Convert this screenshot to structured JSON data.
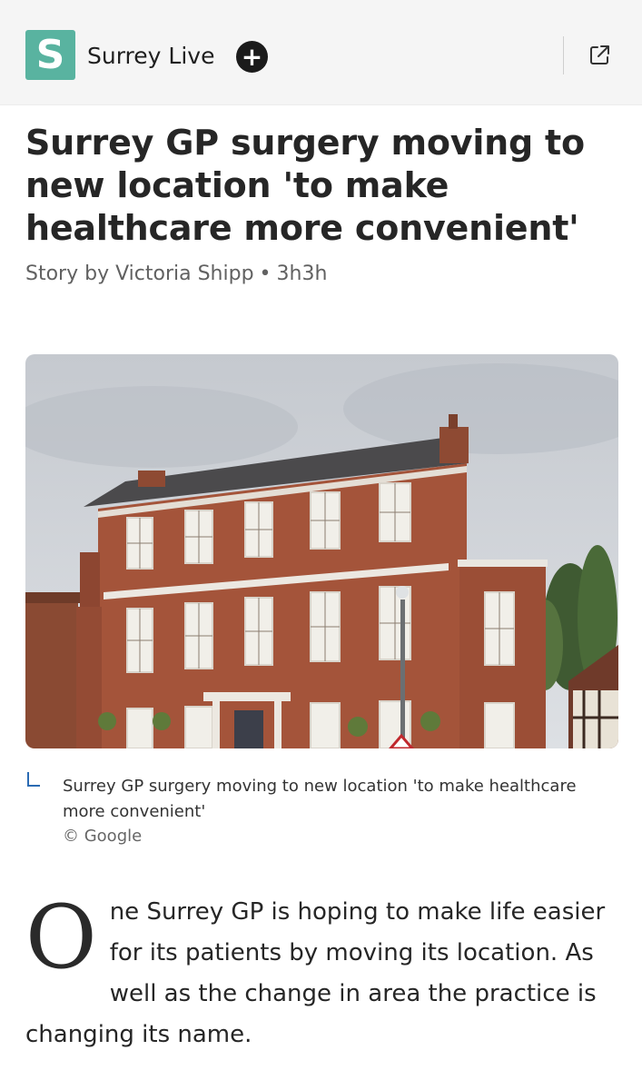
{
  "header": {
    "logo_letter": "S",
    "site_name": "Surrey Live",
    "follow_glyph": "+",
    "brand_color": "#59b3a0",
    "open_icon": "external-link-icon"
  },
  "article": {
    "headline": "Surrey GP surgery moving to new location 'to make healthcare more convenient'",
    "byline": {
      "author": "Story by Victoria Shipp",
      "separator": "•",
      "time": "3h3h"
    },
    "image": {
      "caption": "Surrey GP surgery moving to new location 'to make healthcare more convenient'",
      "credit": "© Google"
    },
    "body": {
      "drop_cap": "O",
      "paragraph": "ne Surrey GP is hoping to make life easier for its patients by moving its location. As well as the change in area the practice is changing its name."
    }
  }
}
